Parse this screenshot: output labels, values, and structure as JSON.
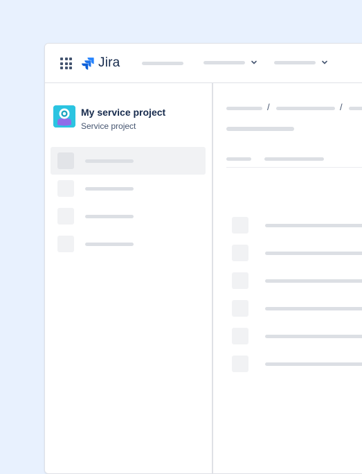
{
  "app": {
    "name": "Jira",
    "brand_color": "#2684ff",
    "page_background": "#e8f1fe"
  },
  "topnav": {
    "app_switcher_icon": "grid-icon",
    "logo_icon": "jira-logo-icon",
    "dropdown_icon": "chevron-down-icon"
  },
  "sidebar": {
    "project": {
      "name": "My service project",
      "type": "Service project",
      "avatar_icon": "service-project-avatar-icon",
      "avatar_color": "#2bc4e1"
    },
    "selected_index": 0
  },
  "main": {
    "breadcrumb_separators": [
      "/",
      "/"
    ]
  }
}
